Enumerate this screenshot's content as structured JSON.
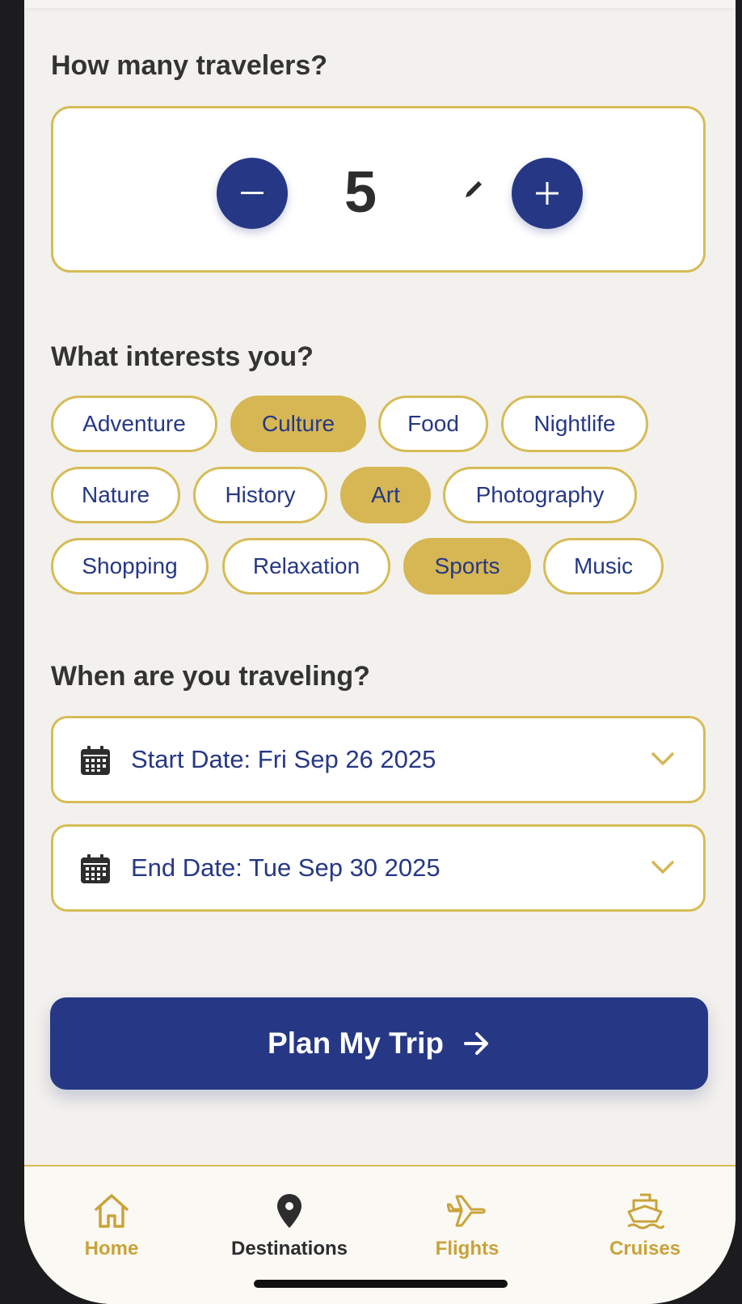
{
  "travelers": {
    "heading": "How many travelers?",
    "count": "5",
    "decrement_symbol": "−",
    "increment_symbol": "+"
  },
  "interests": {
    "heading": "What interests you?",
    "chips": [
      {
        "label": "Adventure",
        "selected": false
      },
      {
        "label": "Culture",
        "selected": true
      },
      {
        "label": "Food",
        "selected": false
      },
      {
        "label": "Nightlife",
        "selected": false
      },
      {
        "label": "Nature",
        "selected": false
      },
      {
        "label": "History",
        "selected": false
      },
      {
        "label": "Art",
        "selected": true
      },
      {
        "label": "Photography",
        "selected": false
      },
      {
        "label": "Shopping",
        "selected": false
      },
      {
        "label": "Relaxation",
        "selected": false
      },
      {
        "label": "Sports",
        "selected": true
      },
      {
        "label": "Music",
        "selected": false
      }
    ]
  },
  "dates": {
    "heading": "When are you traveling?",
    "start_label": "Start Date: Fri Sep 26 2025",
    "end_label": "End Date: Tue Sep 30 2025"
  },
  "cta": {
    "label": "Plan My Trip"
  },
  "tabbar": {
    "tabs": [
      {
        "label": "Home",
        "icon": "home-icon",
        "active": false
      },
      {
        "label": "Destinations",
        "icon": "map-pin-icon",
        "active": true
      },
      {
        "label": "Flights",
        "icon": "airplane-icon",
        "active": false
      },
      {
        "label": "Cruises",
        "icon": "ship-icon",
        "active": false
      }
    ]
  },
  "colors": {
    "navy": "#263885",
    "gold": "#d6bc57",
    "gold_selected": "#d6b754",
    "background": "#f3f1ed"
  }
}
